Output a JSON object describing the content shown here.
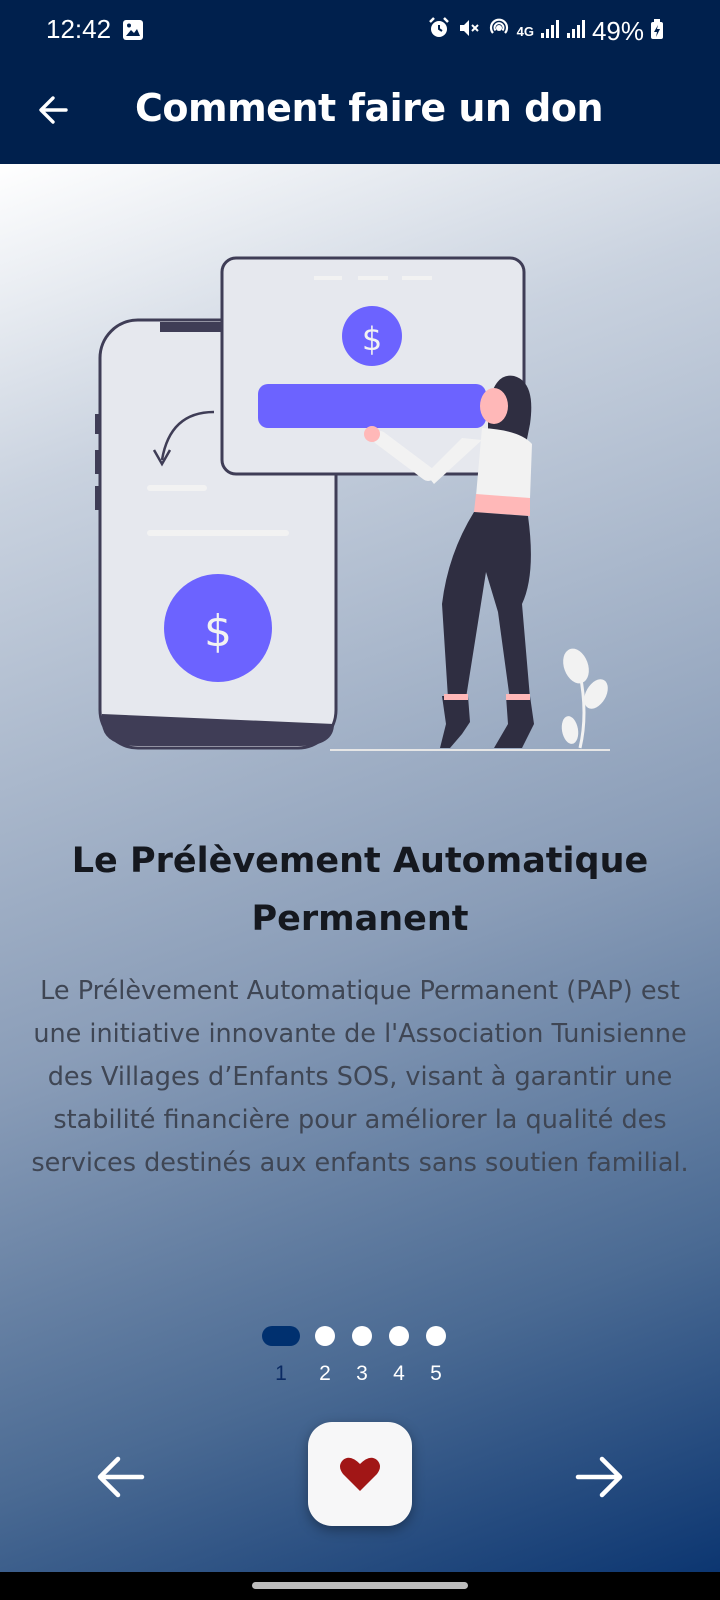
{
  "status_bar": {
    "time": "12:42",
    "network": "4G",
    "battery": "49%"
  },
  "app_bar": {
    "title": "Comment faire un don"
  },
  "slide": {
    "title": "Le Prélèvement Automatique Permanent",
    "description": "Le Prélèvement Automatique Permanent (PAP) est une initiative innovante de l'Association Tunisienne des Villages d’Enfants SOS, visant à garantir une stabilité financière pour améliorer la qualité des services destinés aux enfants sans soutien familial.",
    "illustration_symbol": "$"
  },
  "pagination": {
    "pages": [
      "1",
      "2",
      "3",
      "4",
      "5"
    ],
    "current": 1
  },
  "colors": {
    "header": "#00204d",
    "accent": "#6c63ff",
    "heart": "#a11616",
    "active_dot": "#00306f"
  },
  "icons": {
    "back": "arrow-left-icon",
    "prev": "arrow-left-icon",
    "next": "arrow-right-icon",
    "donate": "heart-icon"
  }
}
